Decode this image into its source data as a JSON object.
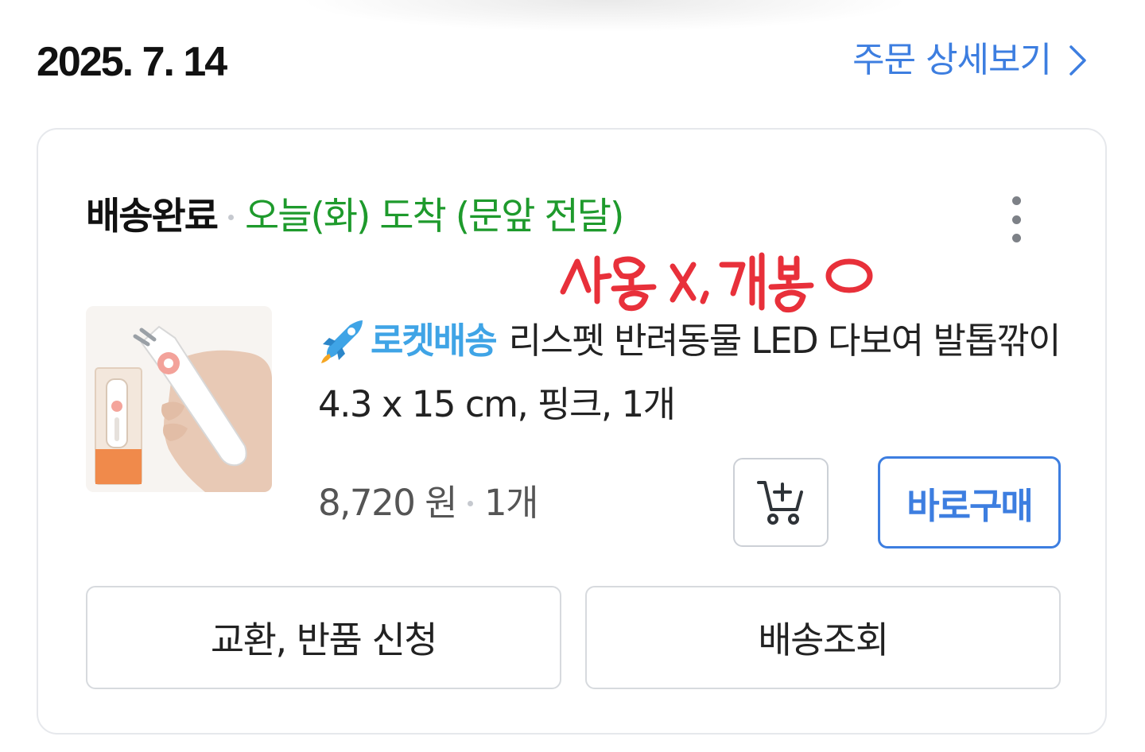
{
  "order": {
    "date": "2025. 7. 14",
    "detail_link_label": "주문 상세보기"
  },
  "shipment": {
    "status": "배송완료",
    "arrival": "오늘(화) 도착 (문앞 전달)",
    "handwritten_note": "사용 X, 개봉 O"
  },
  "product": {
    "delivery_badge": "로켓배송",
    "name": "리스펫 반려동물 LED 다보여 발톱깎이 4.3 x 15 cm, 핑크, 1개",
    "price": "8,720 원",
    "quantity": "1개"
  },
  "actions": {
    "buy_now": "바로구매",
    "exchange_return": "교환, 반품 신청",
    "track_delivery": "배송조회"
  },
  "colors": {
    "accent_blue": "#3d7ee0",
    "arrival_green": "#1e9a2c",
    "rocket_blue": "#3fa4e6",
    "note_red": "#e8303a"
  },
  "icons": {
    "detail_chevron": "chevron-right-icon",
    "more": "more-vertical-icon",
    "rocket": "rocket-icon",
    "cart": "cart-plus-icon"
  }
}
